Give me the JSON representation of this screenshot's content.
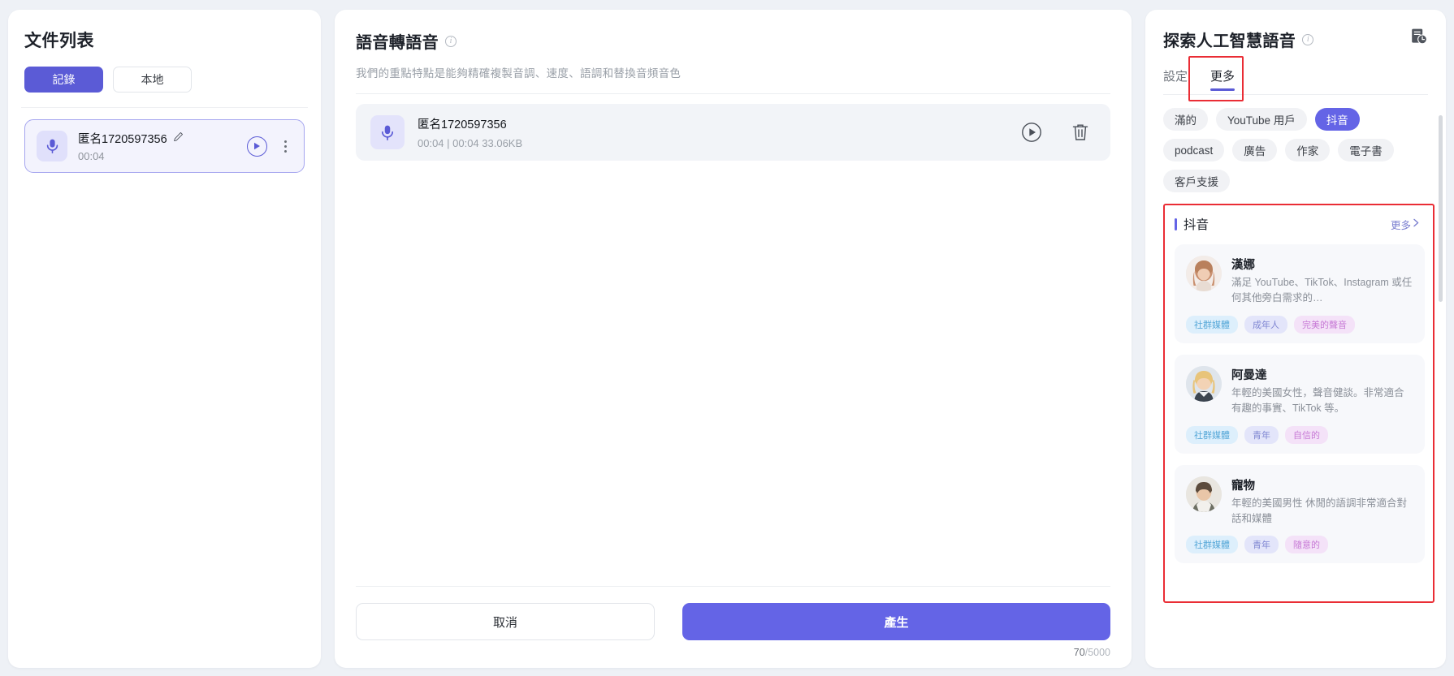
{
  "left_panel": {
    "title": "文件列表",
    "tabs": [
      {
        "label": "記錄",
        "active": true
      },
      {
        "label": "本地",
        "active": false
      }
    ],
    "recordings": [
      {
        "name": "匿名1720597356",
        "duration": "00:04",
        "mic_icon": "microphone-icon",
        "edit_icon": "pencil-edit-icon",
        "play_icon": "play-circle-icon",
        "menu_icon": "kebab-menu-icon"
      }
    ]
  },
  "center_panel": {
    "title": "語音轉語音",
    "info_icon": "info-icon",
    "subtitle": "我們的重點特點是能夠精確複製音調、速度、語調和替換音頻音色",
    "audio_item": {
      "name": "匿名1720597356",
      "info": "00:04  | 00:04 33.06KB",
      "mic_icon": "microphone-icon",
      "play_icon": "play-circle-icon",
      "delete_icon": "trash-icon"
    },
    "actions": {
      "cancel_label": "取消",
      "generate_label": "產生"
    },
    "counter": {
      "current": "70",
      "separator": "/",
      "max": "5000"
    }
  },
  "right_panel": {
    "title": "探索人工智慧語音",
    "info_icon": "info-icon",
    "history_icon": "history-clock-icon",
    "tabs": [
      {
        "label": "設定",
        "active": false
      },
      {
        "label": "更多",
        "active": true
      }
    ],
    "chips": [
      {
        "label": "滿的",
        "selected": false
      },
      {
        "label": "YouTube 用戶",
        "selected": false
      },
      {
        "label": "抖音",
        "selected": true
      },
      {
        "label": "podcast",
        "selected": false
      },
      {
        "label": "廣告",
        "selected": false
      },
      {
        "label": "作家",
        "selected": false
      },
      {
        "label": "電子書",
        "selected": false
      },
      {
        "label": "客戶支援",
        "selected": false
      }
    ],
    "group": {
      "title": "抖音",
      "more_label": "更多",
      "more_icon": "chevron-right-icon",
      "voices": [
        {
          "name": "漢娜",
          "description": "滿足 YouTube、TikTok、Instagram 或任何其他旁白需求的…",
          "avatar": "avatar-hannah",
          "tags": [
            {
              "label": "社群媒體",
              "color": "blue"
            },
            {
              "label": "成年人",
              "color": "indigo"
            },
            {
              "label": "完美的聲音",
              "color": "pink"
            }
          ]
        },
        {
          "name": "阿曼達",
          "description": "年輕的美國女性，聲音健談。非常適合有趣的事實、TikTok 等。",
          "avatar": "avatar-amanda",
          "tags": [
            {
              "label": "社群媒體",
              "color": "blue"
            },
            {
              "label": "青年",
              "color": "indigo"
            },
            {
              "label": "自信的",
              "color": "pink"
            }
          ]
        },
        {
          "name": "寵物",
          "description": "年輕的美國男性 休閒的語調非常適合對話和媒體",
          "avatar": "avatar-pet",
          "tags": [
            {
              "label": "社群媒體",
              "color": "blue"
            },
            {
              "label": "青年",
              "color": "indigo"
            },
            {
              "label": "隨意的",
              "color": "pink"
            }
          ]
        }
      ]
    }
  },
  "colors": {
    "accent": "#6464e6",
    "accent_soft": "#e0e0fb",
    "highlight_box": "#ea2d35",
    "page_bg": "#eef1f6"
  }
}
